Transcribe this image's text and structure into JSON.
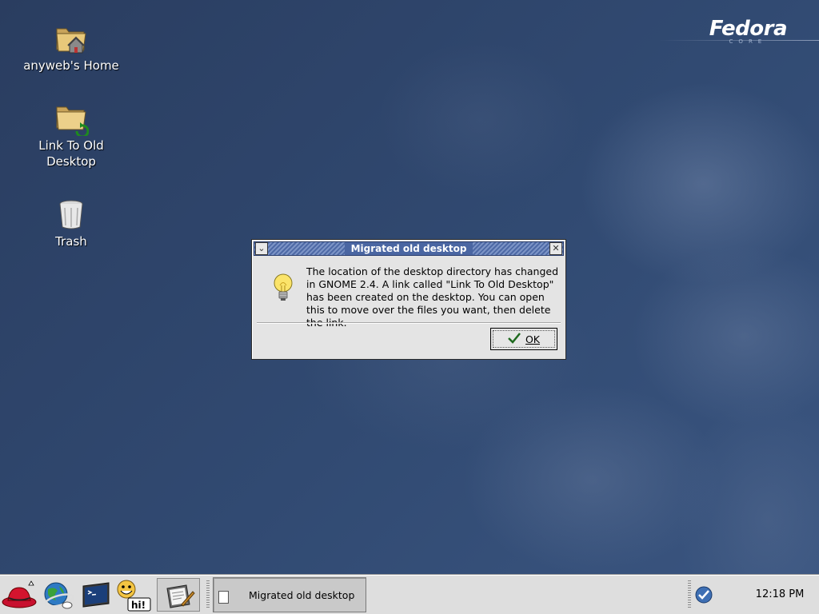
{
  "desktop": {
    "brand": {
      "name": "Fedora",
      "sub": "CORE"
    },
    "icons": [
      {
        "label": "anyweb's Home",
        "icon": "home-folder-icon"
      },
      {
        "label": "Link To Old Desktop",
        "icon": "folder-link-icon"
      },
      {
        "label": "Trash",
        "icon": "trash-icon"
      }
    ]
  },
  "dialog": {
    "title": "Migrated old desktop",
    "message": "The location of the desktop directory has changed in GNOME 2.4. A link called \"Link To Old Desktop\" has been created on the desktop. You can open this to move over the files you want, then delete the link.",
    "ok_label": "OK",
    "icon": "lightbulb-icon"
  },
  "panel": {
    "launchers": [
      "redhat-menu-icon",
      "web-browser-icon",
      "terminal-icon",
      "gaim-hi-icon",
      "notes-editor-icon"
    ],
    "hi_badge": "hi!",
    "tasks": [
      {
        "label": "Migrated old desktop"
      }
    ],
    "tray": [
      "update-checkmark-icon"
    ],
    "clock": "12:18 PM"
  },
  "colors": {
    "desktop_bg": "#2d4266",
    "titlebar": "#4e6aa6",
    "panel_bg": "#dedede"
  }
}
